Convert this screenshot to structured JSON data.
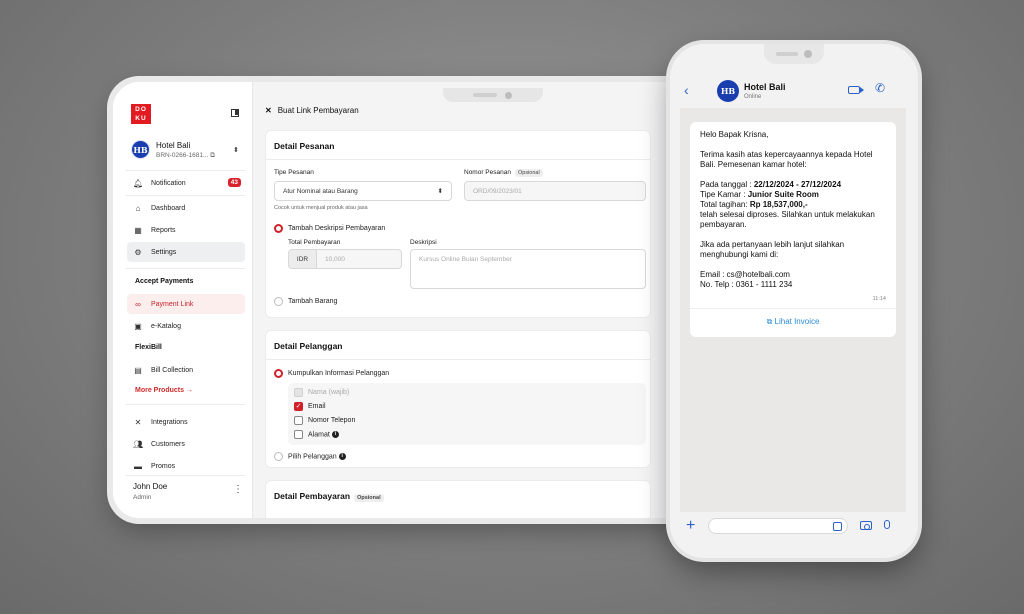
{
  "sidebar": {
    "logo_text": "DOKU",
    "merchant": {
      "initials": "HB",
      "name": "Hotel Bali",
      "id": "BRN-0266-1681..."
    },
    "notification": {
      "label": "Notification",
      "count": "43"
    },
    "items": [
      {
        "label": "Dashboard",
        "icon": "home-icon"
      },
      {
        "label": "Reports",
        "icon": "table-icon"
      },
      {
        "label": "Settings",
        "icon": "settings-icon"
      }
    ],
    "accept_payments": {
      "title": "Accept Payments",
      "items": [
        {
          "label": "Payment Link",
          "icon": "link-icon"
        },
        {
          "label": "e-Katalog",
          "icon": "store-icon"
        }
      ]
    },
    "flexibill": {
      "title": "FlexiBill",
      "items": [
        {
          "label": "Bill Collection",
          "icon": "bill-icon"
        }
      ]
    },
    "more_products": "More Products →",
    "bottom_items": [
      {
        "label": "Integrations",
        "icon": "tools-icon"
      },
      {
        "label": "Customers",
        "icon": "users-icon"
      },
      {
        "label": "Promos",
        "icon": "promo-icon"
      }
    ],
    "user": {
      "name": "John Doe",
      "role": "Admin"
    }
  },
  "main": {
    "title": "Buat Link Pembayaran",
    "detail_pesanan": {
      "heading": "Detail Pesanan",
      "tipe_label": "Tipe Pesanan",
      "tipe_value": "Atur Nominal atau Barang",
      "tipe_hint": "Cocok untuk menjual produk atau jasa",
      "nomor_label": "Nomor Pesanan",
      "nomor_tag": "Opsional",
      "nomor_placeholder": "ORD/09/2023/01",
      "radio_desc": "Tambah Deskripsi Pembayaran",
      "total_label": "Total Pembayaran",
      "currency": "IDR",
      "amount_placeholder": "10,000",
      "deskripsi_label": "Deskripsi",
      "deskripsi_placeholder": "Kursus Online Bulan September",
      "radio_barang": "Tambah Barang"
    },
    "detail_pelanggan": {
      "heading": "Detail Pelanggan",
      "radio_collect": "Kumpulkan Informasi Pelanggan",
      "cb_nama": "Nama (wajib)",
      "cb_email": "Email",
      "cb_telepon": "Nomor Telepon",
      "cb_alamat": "Alamat",
      "radio_pilih": "Pilih Pelanggan"
    },
    "detail_pembayaran": {
      "heading": "Detail Pembayaran",
      "tag": "Opsional"
    }
  },
  "phone": {
    "chat": {
      "initials": "HB",
      "name": "Hotel Bali",
      "status": "Online"
    },
    "message": {
      "greeting": "Helo Bapak Krisna,",
      "p1": "Terima kasih atas kepercayaannya kepada Hotel Bali. Pemesenan kamar hotel:",
      "tanggal_label": "Pada tanggal : ",
      "tanggal_value": "22/12/2024 - 27/12/2024",
      "kamar_label": "Tipe Kamar : ",
      "kamar_value": "Junior Suite Room",
      "tagihan_label": "Total tagihan: ",
      "tagihan_value": "Rp 18,537,000,-",
      "p2_tail": "telah selesai diproses. Silahkan untuk melakukan pembayaran.",
      "p3": "Jika ada pertanyaan lebih lanjut silahkan menghubungi kami di:",
      "email": "Email : cs@hotelbali.com",
      "telp": "No. Telp : 0361 - 1111 234",
      "time": "11:14",
      "invoice_link": "Lihat Invoice"
    }
  },
  "colors": {
    "accent_red": "#d12028",
    "wa_blue": "#2a62c9",
    "hb_blue": "#1a3db0"
  }
}
